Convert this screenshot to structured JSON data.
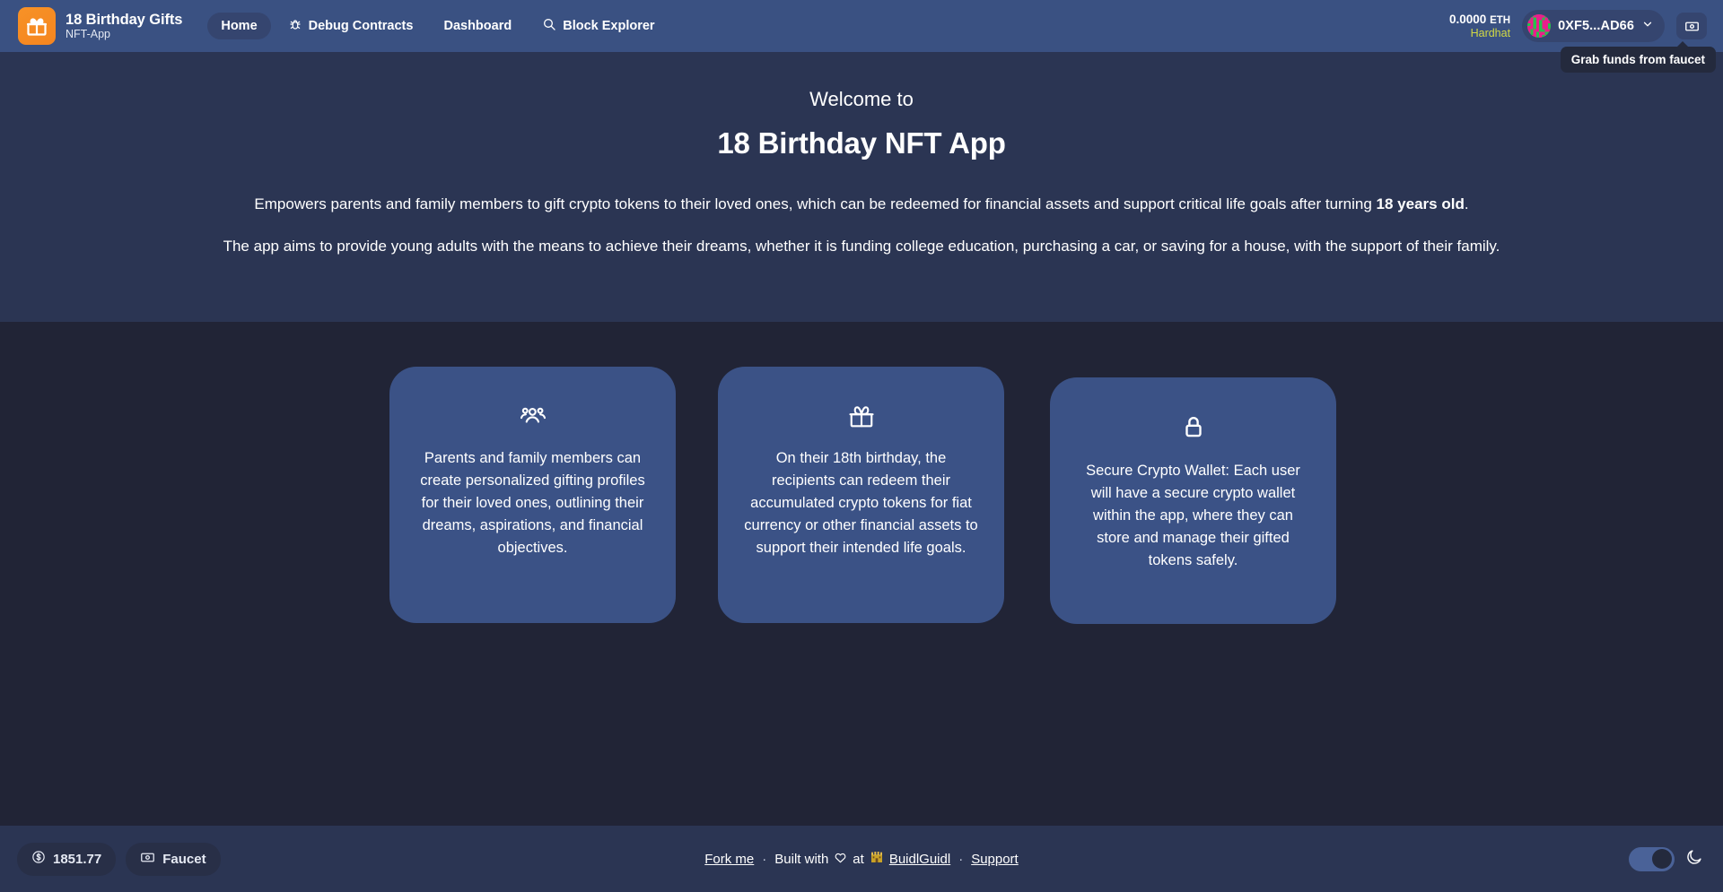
{
  "header": {
    "brand": {
      "logo_icon": "gift-icon",
      "title": "18 Birthday Gifts",
      "subtitle": "NFT-App"
    },
    "nav": [
      {
        "label": "Home",
        "icon": null,
        "active": true
      },
      {
        "label": "Debug Contracts",
        "icon": "bug-icon",
        "active": false
      },
      {
        "label": "Dashboard",
        "icon": null,
        "active": false
      },
      {
        "label": "Block Explorer",
        "icon": "search-icon",
        "active": false
      }
    ],
    "balance": {
      "amount": "0.0000",
      "unit": "ETH",
      "network": "Hardhat",
      "network_color": "#d2d945"
    },
    "wallet": {
      "address": "0XF5...AD66",
      "avatar_icon": "blockie-avatar",
      "chevron_icon": "chevron-down-icon"
    },
    "faucet_button": {
      "icon": "banknote-icon",
      "tooltip": "Grab funds from faucet"
    }
  },
  "hero": {
    "welcome": "Welcome to",
    "title": "18 Birthday NFT App",
    "paragraph1_a": "Empowers parents and family members to gift crypto tokens to their loved ones, which can be redeemed for financial assets and support critical life goals after turning ",
    "paragraph1_bold": "18 years old",
    "paragraph1_b": ".",
    "paragraph2": "The app aims to provide young adults with the means to achieve their dreams, whether it is funding college education, purchasing a car, or saving for a house, with the support of their family."
  },
  "cards": [
    {
      "icon": "users-icon",
      "text": "Parents and family members can create personalized gifting profiles for their loved ones, outlining their dreams, aspirations, and financial objectives."
    },
    {
      "icon": "gift-icon",
      "text": "On their 18th birthday, the recipients can redeem their accumulated crypto tokens for fiat currency or other financial assets to support their intended life goals."
    },
    {
      "icon": "lock-icon",
      "text": "Secure Crypto Wallet: Each user will have a secure crypto wallet within the app, where they can store and manage their gifted tokens safely."
    }
  ],
  "footer": {
    "price_chip": {
      "icon": "dollar-circle-icon",
      "label": "1851.77"
    },
    "faucet_chip": {
      "icon": "banknote-icon",
      "label": "Faucet"
    },
    "fork_me": "Fork me",
    "separator1": "·",
    "built_with": "Built with",
    "heart_icon": "heart-icon",
    "at": "at",
    "castle_icon": "castle-icon",
    "buidlguidl": "BuidlGuidl",
    "separator2": "·",
    "support": "Support",
    "theme_toggle": {
      "state": "on",
      "icon": "moon-icon"
    }
  },
  "colors": {
    "header_bg": "#3a5182",
    "hero_bg": "#2b3553",
    "page_bg": "#212436",
    "card_bg": "#3b5286",
    "brand_orange": "#f5851f",
    "network_yellow": "#d2d945"
  }
}
